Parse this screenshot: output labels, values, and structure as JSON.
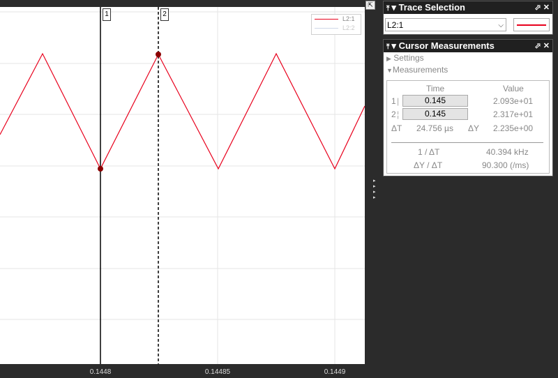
{
  "plot": {
    "x_ticks": [
      "0.1448",
      "0.14485",
      "0.1449"
    ],
    "cursor_tags": [
      "1",
      "2"
    ],
    "legend": [
      {
        "label": "L2:1",
        "color": "#e8001c"
      },
      {
        "label": "L2:2",
        "color": "#cfd8e8"
      }
    ],
    "trace_color": "#e8001c",
    "marker_color": "#8b0000",
    "background": "#ffffff",
    "grid_color": "#e4e4e4"
  },
  "trace_panel": {
    "title": "Trace Selection",
    "selected_trace": "L2:1"
  },
  "cursor_panel": {
    "title": "Cursor Measurements",
    "settings_label": "Settings",
    "measurements_label": "Measurements",
    "col_time": "Time",
    "col_value": "Value",
    "row1_index": "1",
    "row1_time": "0.145",
    "row1_value": "2.093e+01",
    "row2_index": "2",
    "row2_time": "0.145",
    "row2_value": "2.317e+01",
    "dt_label": "ΔT",
    "dt_value": "24.756 µs",
    "dy_label": "ΔY",
    "dy_value": "2.235e+00",
    "inv_dt_label": "1 / ΔT",
    "inv_dt_value": "40.394 kHz",
    "slope_label": "ΔY / ΔT",
    "slope_value": "90.300 (/ms)"
  }
}
